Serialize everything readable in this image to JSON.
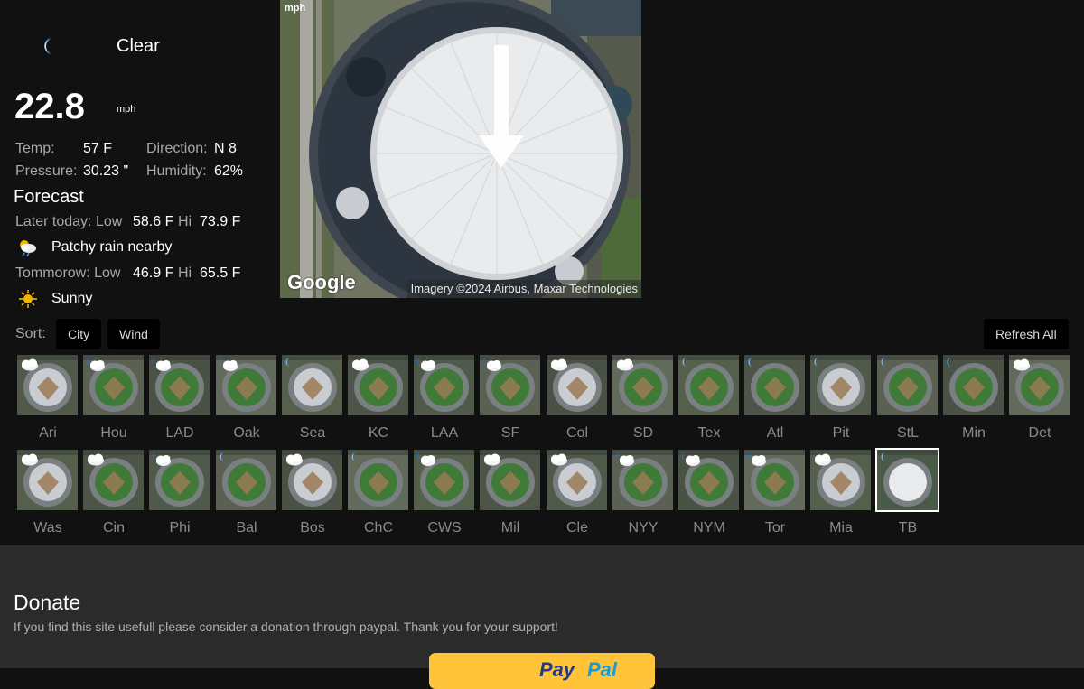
{
  "current": {
    "condition": "Clear",
    "condition_icon": "moon-icon",
    "wind_speed": "22.8",
    "wind_unit": "mph",
    "labels": {
      "temp": "Temp:",
      "direction": "Direction:",
      "pressure": "Pressure:",
      "humidity": "Humidity:"
    },
    "temp": "57 F",
    "direction": "N 8",
    "pressure": "30.23 \"",
    "humidity": "62%"
  },
  "forecast": {
    "title": "Forecast",
    "later": {
      "label": "Later today: Low",
      "low": "58.6 F",
      "hi_label": "Hi",
      "hi": "73.9 F",
      "icon": "patchy-rain-icon",
      "condition": "Patchy rain nearby"
    },
    "tomorrow": {
      "label": "Tommorow: Low",
      "low": "46.9 F",
      "hi_label": "Hi",
      "hi": "65.5 F",
      "icon": "sun-icon",
      "condition": "Sunny"
    }
  },
  "map": {
    "unit_label": "mph",
    "logo": "Google",
    "credit": "Imagery ©2024 Airbus, Maxar Technologies"
  },
  "sort": {
    "label": "Sort:",
    "city": "City",
    "wind": "Wind",
    "refresh": "Refresh All"
  },
  "teams": [
    {
      "label": "Ari",
      "icon": "cloud-icon"
    },
    {
      "label": "Hou",
      "icon": "moon-cloud-icon"
    },
    {
      "label": "LAD",
      "icon": "moon-cloud-icon"
    },
    {
      "label": "Oak",
      "icon": "moon-cloud-icon"
    },
    {
      "label": "Sea",
      "icon": "moon-icon"
    },
    {
      "label": "KC",
      "icon": "cloud-icon"
    },
    {
      "label": "LAA",
      "icon": "moon-cloud-icon"
    },
    {
      "label": "SF",
      "icon": "moon-cloud-icon"
    },
    {
      "label": "Col",
      "icon": "cloud-icon"
    },
    {
      "label": "SD",
      "icon": "cloud-icon"
    },
    {
      "label": "Tex",
      "icon": "moon-icon"
    },
    {
      "label": "Atl",
      "icon": "moon-icon"
    },
    {
      "label": "Pit",
      "icon": "moon-icon"
    },
    {
      "label": "StL",
      "icon": "moon-icon"
    },
    {
      "label": "Min",
      "icon": "moon-icon"
    },
    {
      "label": "Det",
      "icon": "cloud-icon"
    },
    {
      "label": "Was",
      "icon": "cloud-icon"
    },
    {
      "label": "Cin",
      "icon": "cloud-icon"
    },
    {
      "label": "Phi",
      "icon": "moon-cloud-icon"
    },
    {
      "label": "Bal",
      "icon": "moon-icon"
    },
    {
      "label": "Bos",
      "icon": "cloud-icon"
    },
    {
      "label": "ChC",
      "icon": "moon-icon"
    },
    {
      "label": "CWS",
      "icon": "moon-cloud-icon"
    },
    {
      "label": "Mil",
      "icon": "cloud-icon"
    },
    {
      "label": "Cle",
      "icon": "cloud-icon"
    },
    {
      "label": "NYY",
      "icon": "moon-cloud-icon"
    },
    {
      "label": "NYM",
      "icon": "moon-cloud-icon"
    },
    {
      "label": "Tor",
      "icon": "moon-cloud-icon"
    },
    {
      "label": "Mia",
      "icon": "cloud-icon"
    },
    {
      "label": "TB",
      "icon": "moon-icon",
      "selected": true
    }
  ],
  "footer": {
    "title": "Donate",
    "text": "If you find this site usefull please consider a donation through paypal. Thank you for your support!",
    "paypal_1": "Pay",
    "paypal_2": "Pal"
  }
}
